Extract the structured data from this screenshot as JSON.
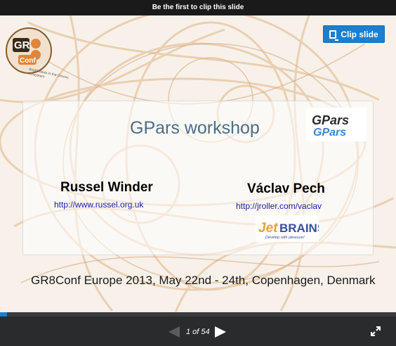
{
  "topbar": {
    "text": "Be the first to clip this slide"
  },
  "clip_button": {
    "label": "Clip slide"
  },
  "slide": {
    "logo": {
      "line1": "GR",
      "line2": "Conf",
      "tagline": "Bright ideas in the Groovy ecosystem"
    },
    "title": "GPars workshop",
    "gpars_logo": {
      "text": "GPars"
    },
    "left_presenter": {
      "name": "Russel Winder",
      "url": "http://www.russel.org.uk"
    },
    "right_presenter": {
      "name": "Václav Pech",
      "url": "http://jroller.com/vaclav"
    },
    "company_logo": {
      "name": "JetBRAINS",
      "tagline": "Develop with pleasure!"
    },
    "footer": "GR8Conf Europe 2013, May 22nd - 24th, Copenhagen, Denmark"
  },
  "player": {
    "current": 1,
    "total": 54,
    "counter_text": "1 of 54",
    "progress_fraction": 0.0185
  },
  "colors": {
    "accent": "#1b7fd1",
    "title": "#4d6c84"
  }
}
